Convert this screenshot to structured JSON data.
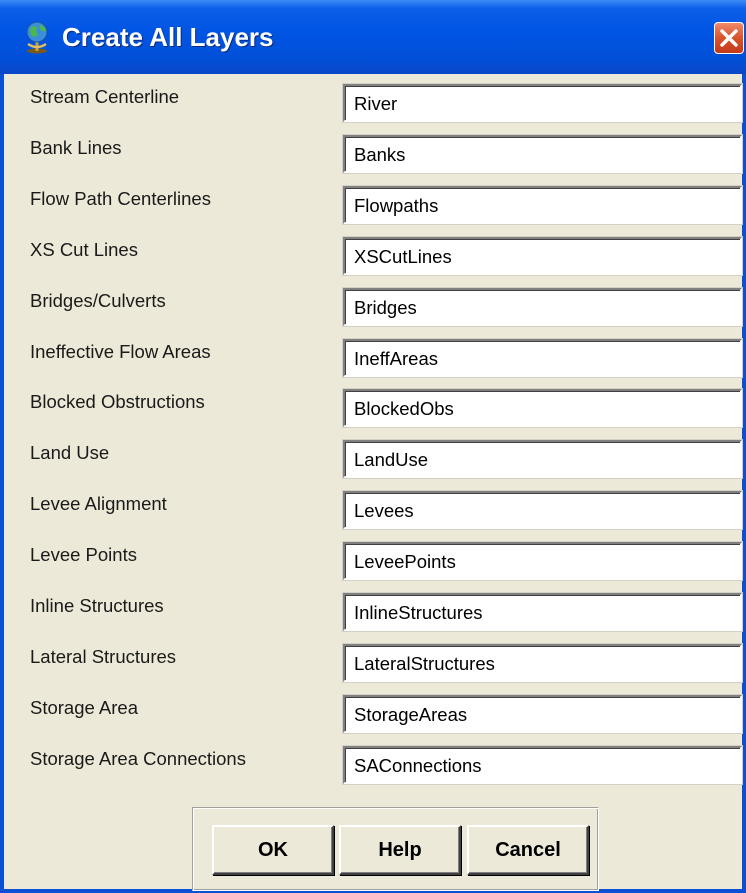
{
  "window": {
    "title": "Create All Layers",
    "icon": "globe-icon"
  },
  "layers": [
    {
      "label": "Stream Centerline",
      "value": "River"
    },
    {
      "label": "Bank Lines",
      "value": "Banks"
    },
    {
      "label": "Flow Path Centerlines",
      "value": "Flowpaths"
    },
    {
      "label": "XS Cut Lines",
      "value": "XSCutLines"
    },
    {
      "label": "Bridges/Culverts",
      "value": "Bridges"
    },
    {
      "label": "Ineffective Flow Areas",
      "value": "IneffAreas"
    },
    {
      "label": "Blocked Obstructions",
      "value": "BlockedObs"
    },
    {
      "label": "Land Use",
      "value": "LandUse"
    },
    {
      "label": "Levee Alignment",
      "value": "Levees"
    },
    {
      "label": "Levee Points",
      "value": "LeveePoints"
    },
    {
      "label": "Inline Structures",
      "value": "InlineStructures"
    },
    {
      "label": "Lateral Structures",
      "value": "LateralStructures"
    },
    {
      "label": "Storage Area",
      "value": "StorageAreas"
    },
    {
      "label": "Storage Area Connections",
      "value": "SAConnections"
    }
  ],
  "buttons": {
    "ok": "OK",
    "help": "Help",
    "cancel": "Cancel"
  },
  "colors": {
    "titlebar": "#0054e3",
    "dialog_bg": "#ece9d8",
    "close_button": "#d9532c"
  }
}
